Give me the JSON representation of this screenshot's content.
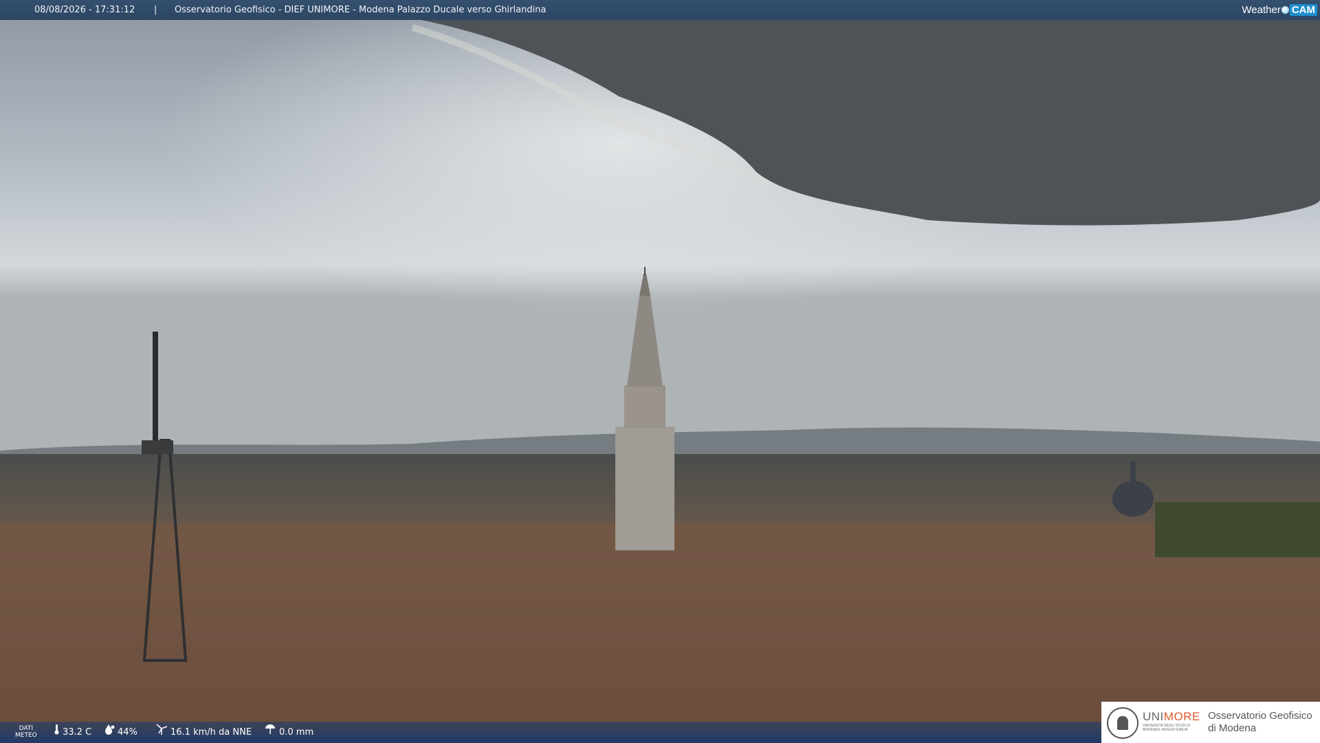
{
  "header": {
    "datetime": "08/08/2026 - 17:31:12",
    "separator": "|",
    "camera_title": "Osservatorio Geofisico - DIEF UNIMORE - Modena Palazzo Ducale verso Ghirlandina",
    "logo_weather": "Weather",
    "logo_cam": "CAM"
  },
  "weather": {
    "dati_label_1": "DATI",
    "dati_label_2": "METEO",
    "temperature": "33.2 C",
    "humidity": "44%",
    "wind": "16.1 km/h da NNE",
    "rain": "0.0 mm",
    "icons": [
      "thermometer-icon",
      "humidity-drop-icon",
      "wind-turbine-icon",
      "rain-gauge-icon"
    ]
  },
  "sponsor": {
    "brand_uni": "UNI",
    "brand_more": "MORE",
    "brand_sub": "UNIVERSITÀ DEGLI STUDI DI MODENA E REGGIO EMILIA",
    "observatory_line1": "Osservatorio Geofisico",
    "observatory_line2": "di Modena"
  },
  "colors": {
    "header_bg": "#2c4663",
    "brand_orange": "#e05a2a",
    "weathercam_blue": "#1e8fd0"
  }
}
